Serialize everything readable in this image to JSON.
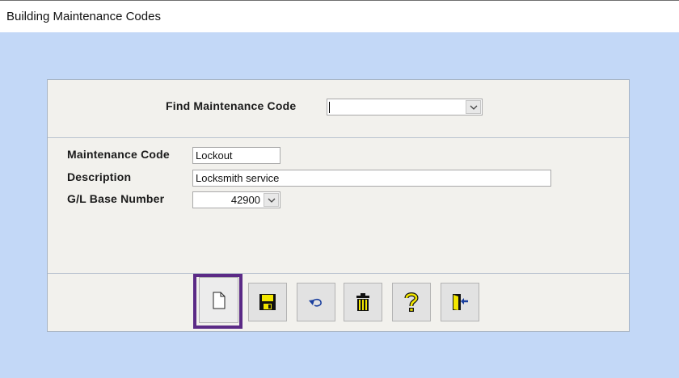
{
  "window": {
    "title": "Building Maintenance Codes"
  },
  "find": {
    "label": "Find Maintenance Code",
    "value": ""
  },
  "form": {
    "maintenance_code_label": "Maintenance Code",
    "maintenance_code_value": "Lockout",
    "description_label": "Description",
    "description_value": "Locksmith service",
    "gl_label": "G/L Base Number",
    "gl_value": "42900"
  },
  "toolbar": {
    "buttons": [
      {
        "icon": "new-document-icon"
      },
      {
        "icon": "save-disk-icon"
      },
      {
        "icon": "undo-arrow-icon"
      },
      {
        "icon": "trash-can-icon"
      },
      {
        "icon": "question-mark-icon"
      },
      {
        "icon": "exit-door-icon"
      }
    ],
    "selected": "new-document-icon"
  },
  "colors": {
    "background": "#c3d8f7",
    "panel": "#f2f1ed",
    "highlight": "#5b2a86",
    "icon_yellow": "#f2e600"
  }
}
